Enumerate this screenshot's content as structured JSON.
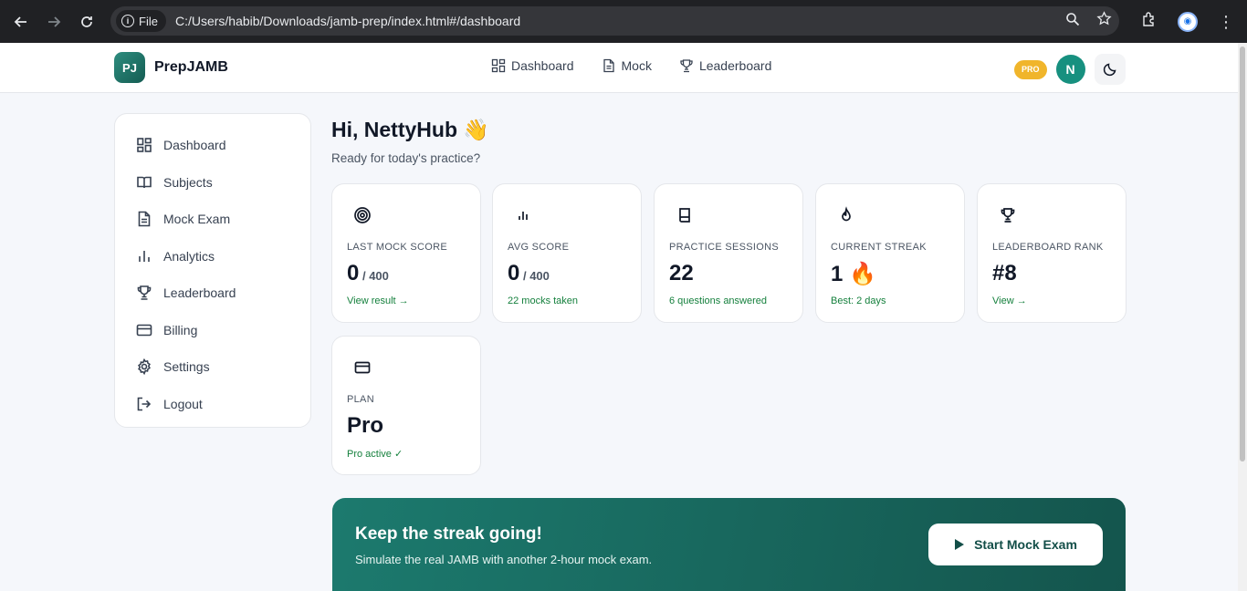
{
  "browser": {
    "file_label": "File",
    "url": "C:/Users/habib/Downloads/jamb-prep/index.html#/dashboard"
  },
  "brand": {
    "logo_text": "PJ",
    "name": "PrepJAMB"
  },
  "topnav": [
    {
      "label": "Dashboard",
      "icon": "grid-icon"
    },
    {
      "label": "Mock",
      "icon": "document-icon"
    },
    {
      "label": "Leaderboard",
      "icon": "trophy-icon"
    }
  ],
  "header": {
    "badge": "PRO",
    "avatar_initial": "N"
  },
  "sidebar": {
    "items": [
      {
        "label": "Dashboard",
        "icon": "grid-icon"
      },
      {
        "label": "Subjects",
        "icon": "book-open-icon"
      },
      {
        "label": "Mock Exam",
        "icon": "document-icon"
      },
      {
        "label": "Analytics",
        "icon": "bar-chart-icon"
      },
      {
        "label": "Leaderboard",
        "icon": "trophy-icon"
      },
      {
        "label": "Billing",
        "icon": "credit-card-icon"
      },
      {
        "label": "Settings",
        "icon": "gear-icon"
      },
      {
        "label": "Logout",
        "icon": "logout-icon"
      }
    ]
  },
  "greeting": {
    "title": "Hi, NettyHub 👋",
    "subtitle": "Ready for today's practice?"
  },
  "cards": [
    {
      "label": "LAST MOCK SCORE",
      "value": "0",
      "of": " / 400",
      "sub": "View result →",
      "icon": "target-icon"
    },
    {
      "label": "AVG SCORE",
      "value": "0",
      "of": " / 400",
      "sub": "22 mocks taken",
      "icon": "bar-chart-icon"
    },
    {
      "label": "PRACTICE SESSIONS",
      "value": "22",
      "of": "",
      "sub": "6 questions answered",
      "icon": "book-icon"
    },
    {
      "label": "CURRENT STREAK",
      "value": "1 🔥",
      "of": "",
      "sub": "Best: 2 days",
      "icon": "flame-icon"
    },
    {
      "label": "LEADERBOARD RANK",
      "value": "#8",
      "of": "",
      "sub": "View →",
      "icon": "trophy-icon"
    },
    {
      "label": "PLAN",
      "value": "Pro",
      "of": "",
      "sub": "Pro active ✓",
      "icon": "credit-card-icon"
    }
  ],
  "banner": {
    "title": "Keep the streak going!",
    "subtitle": "Simulate the real JAMB with another 2-hour mock exam.",
    "button": "Start Mock Exam"
  }
}
